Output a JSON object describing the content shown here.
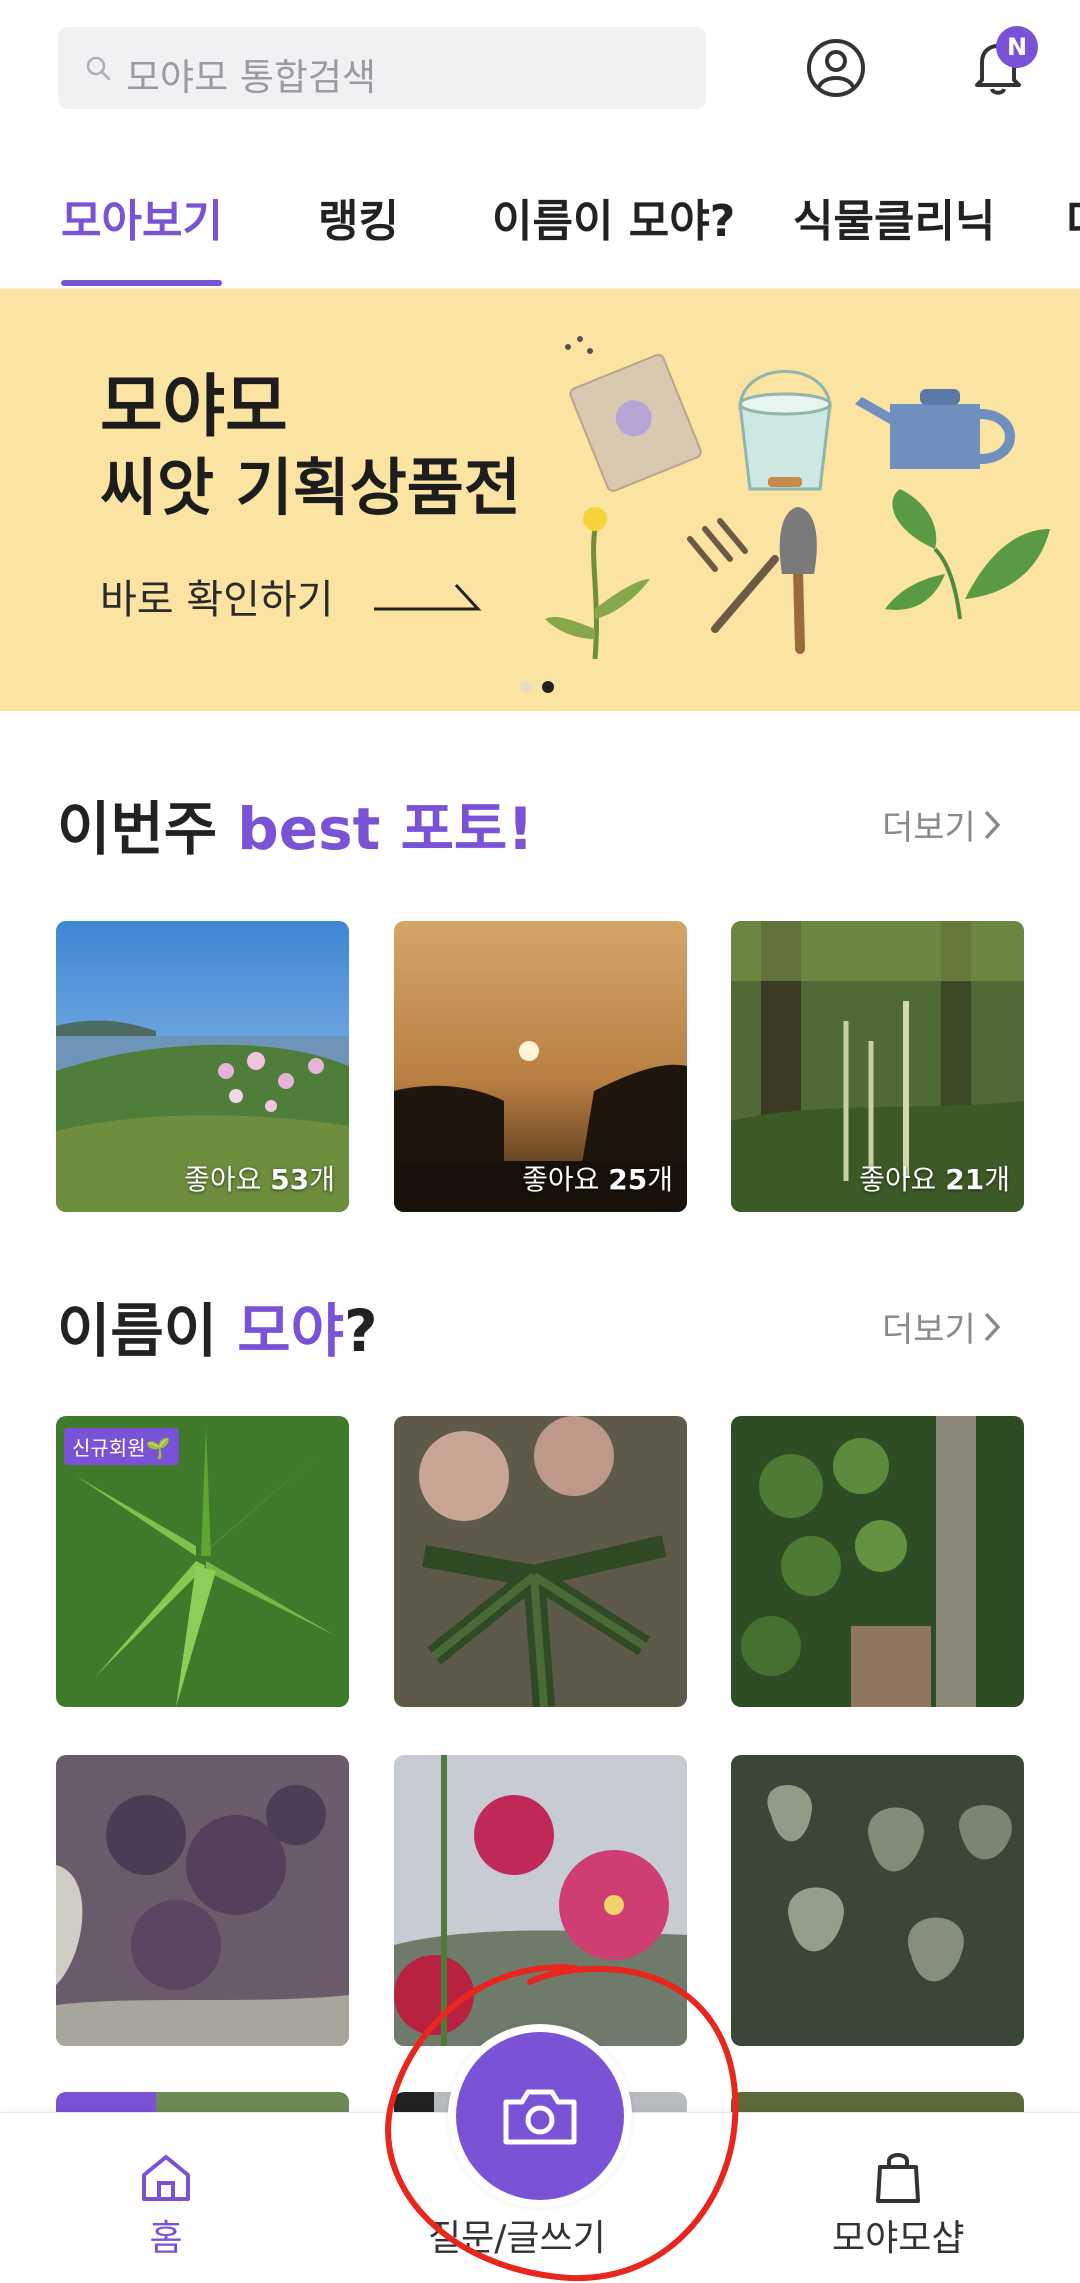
{
  "search": {
    "placeholder": "모야모 통합검색"
  },
  "header": {
    "notification_badge": "N"
  },
  "tabs": [
    {
      "label": "모아보기",
      "active": true
    },
    {
      "label": "랭킹"
    },
    {
      "label": "이름이 모야?"
    },
    {
      "label": "식물클리닉"
    },
    {
      "label": "더"
    }
  ],
  "banner": {
    "title_line1": "모야모",
    "title_line2": "씨앗 기획상품전",
    "cta": "바로 확인하기",
    "page_index": 2,
    "page_count": 2
  },
  "best_photos": {
    "title_prefix": "이번주 ",
    "title_accent": "best 포토!",
    "more_label": "더보기",
    "items": [
      {
        "like_prefix": "좋아요 ",
        "count": "53",
        "like_suffix": "개"
      },
      {
        "like_prefix": "좋아요 ",
        "count": "25",
        "like_suffix": "개"
      },
      {
        "like_prefix": "좋아요 ",
        "count": "21",
        "like_suffix": "개"
      }
    ]
  },
  "name_section": {
    "title_prefix": "이름이 ",
    "title_accent": "모야",
    "title_suffix": "?",
    "more_label": "더보기",
    "new_member_badge": "신규회원🌱"
  },
  "bottom_nav": {
    "home_label": "홈",
    "write_label": "질문/글쓰기",
    "shop_label": "모야모샵"
  },
  "colors": {
    "accent": "#7a52d6",
    "banner_bg": "#fbe3a2",
    "annotation": "#e8261e"
  }
}
